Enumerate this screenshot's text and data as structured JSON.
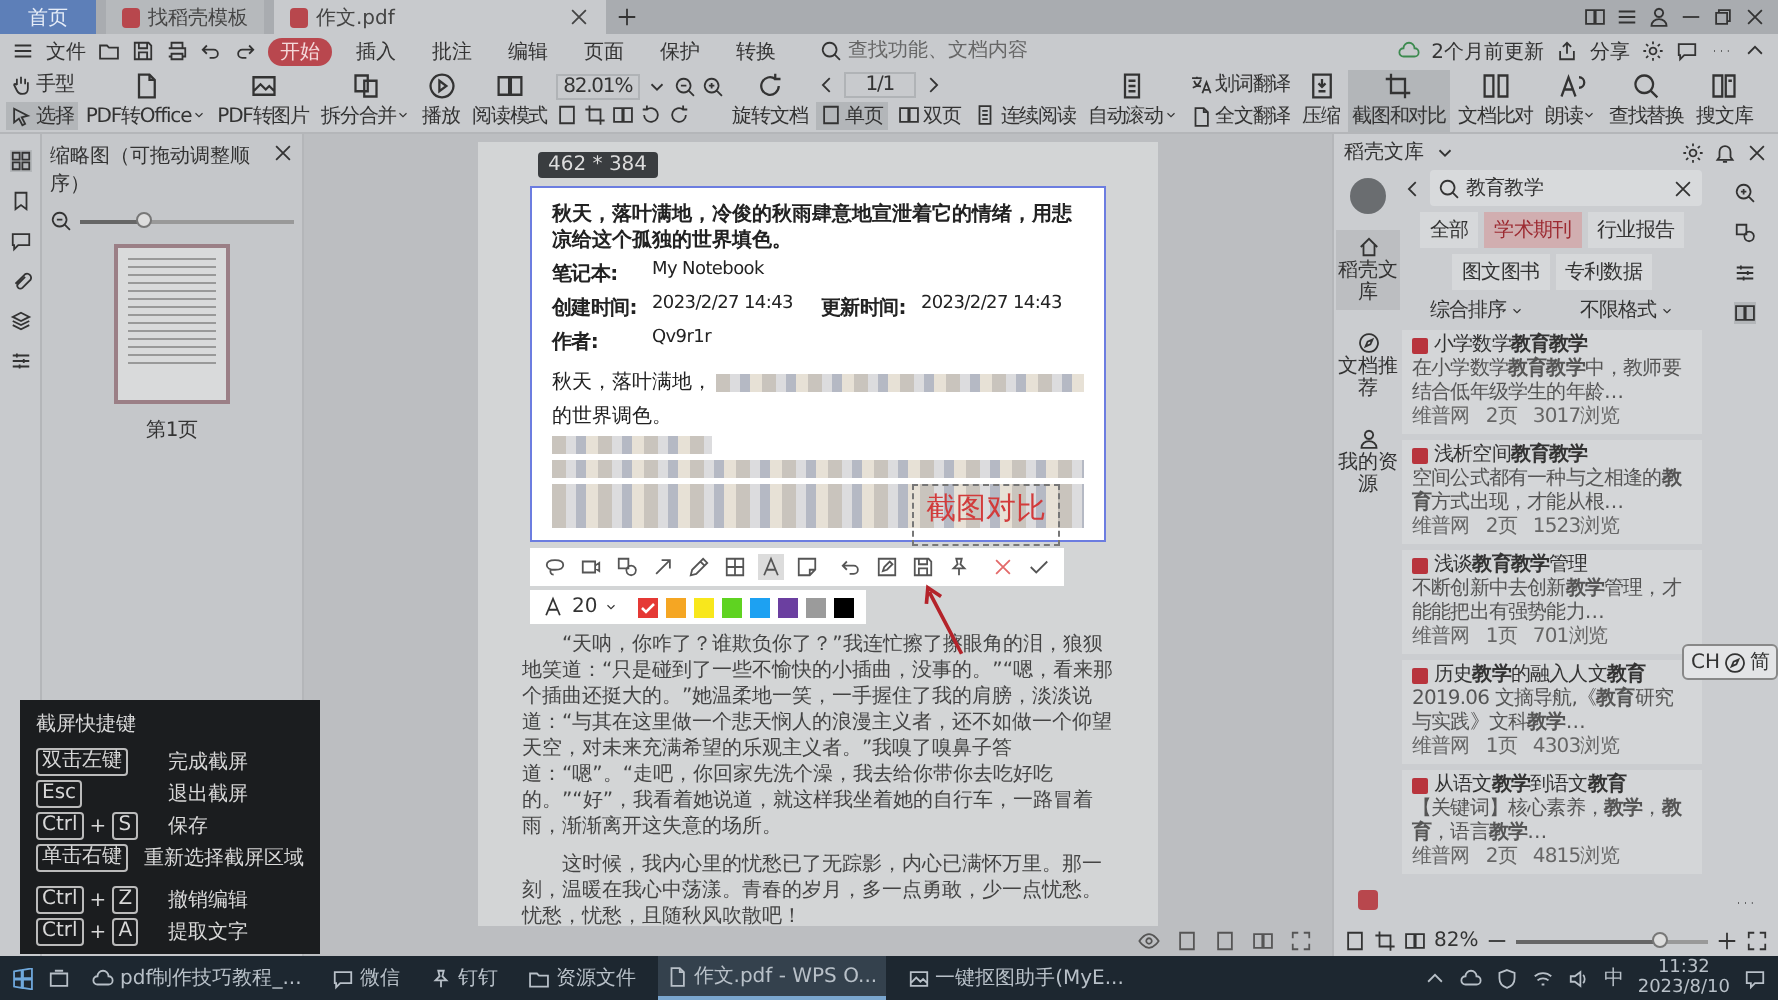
{
  "tabs": [
    {
      "label": "首页",
      "kind": "home",
      "selected": false
    },
    {
      "label": "找稻壳模板",
      "kind": "doc",
      "selected": false
    },
    {
      "label": "作文.pdf",
      "kind": "doc",
      "selected": true
    }
  ],
  "menu": {
    "file": "文件",
    "items": [
      {
        "label": "开始",
        "selected": true
      },
      {
        "label": "插入",
        "selected": false
      },
      {
        "label": "批注",
        "selected": false
      },
      {
        "label": "编辑",
        "selected": false
      },
      {
        "label": "页面",
        "selected": false
      },
      {
        "label": "保护",
        "selected": false
      },
      {
        "label": "转换",
        "selected": false
      }
    ],
    "search": {
      "placeholder": "查找功能、文档内容"
    },
    "update": "2个月前更新",
    "share": "分享"
  },
  "toolbar": [
    {
      "kind": "stack",
      "items": [
        {
          "label": "手型",
          "selected": false
        },
        {
          "label": "选择",
          "selected": true
        }
      ]
    },
    {
      "kind": "big",
      "label": "PDF转Office",
      "dropdown": true,
      "selected": false
    },
    {
      "kind": "big",
      "label": "PDF转图片",
      "dropdown": false,
      "selected": false
    },
    {
      "kind": "big",
      "label": "拆分合并",
      "dropdown": true,
      "selected": false
    },
    {
      "kind": "big",
      "label": "播放",
      "dropdown": false,
      "selected": false
    },
    {
      "kind": "big",
      "label": "阅读模式",
      "dropdown": false,
      "selected": false
    },
    {
      "kind": "zoom",
      "value": "82.01%"
    },
    {
      "kind": "big",
      "label": "旋转文档",
      "dropdown": false,
      "selected": false
    },
    {
      "kind": "nav",
      "value": "1/1",
      "modes": [
        {
          "label": "单页",
          "selected": true
        },
        {
          "label": "双页",
          "selected": false
        },
        {
          "label": "连续阅读",
          "selected": false
        }
      ]
    },
    {
      "kind": "big",
      "label": "自动滚动",
      "dropdown": true,
      "selected": false
    },
    {
      "kind": "stack",
      "items": [
        {
          "label": "划词翻译",
          "selected": false
        },
        {
          "label": "全文翻译",
          "selected": false
        }
      ]
    },
    {
      "kind": "big",
      "label": "压缩",
      "dropdown": false,
      "selected": false
    },
    {
      "kind": "big",
      "label": "截图和对比",
      "dropdown": false,
      "selected": true
    },
    {
      "kind": "big",
      "label": "文档比对",
      "dropdown": false,
      "selected": false
    },
    {
      "kind": "big",
      "label": "朗读",
      "dropdown": true,
      "selected": false
    },
    {
      "kind": "big",
      "label": "查找替换",
      "dropdown": false,
      "selected": false
    },
    {
      "kind": "big",
      "label": "搜文库",
      "dropdown": false,
      "selected": false
    }
  ],
  "thumbnails": {
    "title": "缩略图（可拖动调整顺序）",
    "level": 0.3,
    "page_label": "第1页"
  },
  "document": {
    "size_tag": "462 * 384",
    "title": "秋天，落叶满地，冷俊的秋雨肆意地宣泄着它的情绪，用悲凉给这个孤独的世界填色。",
    "meta": [
      [
        {
          "label": "笔记本:",
          "value": "My Notebook"
        }
      ],
      [
        {
          "label": "创建时间:",
          "value": "2023/2/27 14:43"
        },
        {
          "label": "更新时间:",
          "value": "2023/2/27 14:43"
        }
      ],
      [
        {
          "label": "作者:",
          "value": "Qv9r1r"
        }
      ]
    ],
    "intro": "秋天，落叶满地，",
    "intro_end": "的世界调色。",
    "overlay_text": "截图对比",
    "tools": [
      {
        "selected": false
      },
      {
        "selected": false
      },
      {
        "selected": false
      },
      {
        "selected": false
      },
      {
        "selected": false
      },
      {
        "selected": false
      },
      {
        "selected": true
      },
      {
        "selected": false
      },
      {
        "selected": false
      },
      {
        "selected": false
      },
      {
        "selected": false
      },
      {
        "selected": false
      },
      {
        "selected": false
      },
      {
        "selected": false
      }
    ],
    "font_size": "20",
    "colors": [
      {
        "color": "#e53935",
        "selected": true
      },
      {
        "color": "#f5a623",
        "selected": false
      },
      {
        "color": "#f8e71c",
        "selected": false
      },
      {
        "color": "#5fd321",
        "selected": false
      },
      {
        "color": "#1da1f2",
        "selected": false
      },
      {
        "color": "#6b3fa0",
        "selected": false
      },
      {
        "color": "#9b9b9b",
        "selected": false
      },
      {
        "color": "#000000",
        "selected": false
      }
    ],
    "paragraphs": [
      "“天呐，你咋了？谁欺负你了？”我连忙擦了擦眼角的泪，狼狈地笑道：“只是碰到了一些不愉快的小插曲，没事的。”“嗯，看来那个插曲还挺大的。”她温柔地一笑，一手握住了我的肩膀，淡淡说道：“与其在这里做一个悲天悯人的浪漫主义者，还不如做一个仰望天空，对未来充满希望的乐观主义者。”我嗅了嗅鼻子答道：“嗯”。“走吧，你回家先洗个澡，我去给你带你去吃好吃的。”“好”，我看着她说道，就这样我坐着她的自行车，一路冒着雨，渐渐离开这失意的场所。",
      "这时候，我内心里的忧愁已了无踪影，内心已满怀万里。那一刻，温暖在我心中荡漾。青春的岁月，多一点勇敢，少一点忧愁。忧愁，忧愁，且随秋风吹散吧！"
    ]
  },
  "library": {
    "title": "稻壳文库",
    "nav": [
      {
        "label": "稻壳文库",
        "selected": true
      },
      {
        "label": "文档推荐",
        "selected": false
      },
      {
        "label": "我的资源",
        "selected": false
      }
    ],
    "search": {
      "value": "教育教学"
    },
    "filters": [
      {
        "label": "全部",
        "selected": false
      },
      {
        "label": "学术期刊",
        "selected": true
      },
      {
        "label": "行业报告",
        "selected": false
      },
      {
        "label": "图文图书",
        "selected": false
      },
      {
        "label": "专利数据",
        "selected": false
      }
    ],
    "sorts": [
      "综合排序",
      "不限格式"
    ],
    "cards": [
      {
        "title": "小学数学**教育教学**",
        "desc": "在小学数学**教育教学**中，教师要结合低年级学生的年龄…",
        "source": "维普网",
        "pages": "2页",
        "views": "3017浏览"
      },
      {
        "title": "浅析空间**教育教学**",
        "desc": "空间公式都有一种与之相逢的**教育**方式出现，才能从根…",
        "source": "维普网",
        "pages": "2页",
        "views": "1523浏览"
      },
      {
        "title": "浅谈**教育教学**管理",
        "desc": "不断创新中去创新**教学**管理，才能能把出有强势能力…",
        "source": "维普网",
        "pages": "1页",
        "views": "701浏览"
      },
      {
        "title": "历史**教学**的融入人文**教育**",
        "desc": "2019.06 文摘导航,《**教育**研究与实践》文科**教学**…",
        "source": "维普网",
        "pages": "1页",
        "views": "4303浏览"
      },
      {
        "title": "从语文**教学**到语文**教育**",
        "desc": "【关键词】核心素养，**教学**，**教育**，语言**教学**…",
        "source": "维普网",
        "pages": "2页",
        "views": "4815浏览"
      }
    ],
    "zoom": {
      "value": "82%",
      "level": 0.75
    }
  },
  "ime_badge": {
    "left": "CH",
    "right": "简"
  },
  "shortcuts": {
    "title": "截屏快捷键",
    "joiner": "+",
    "rows": [
      {
        "keys": [
          "双击左键"
        ],
        "action": "完成截屏"
      },
      {
        "keys": [
          "Esc"
        ],
        "action": "退出截屏"
      },
      {
        "keys": [
          "Ctrl",
          "S"
        ],
        "action": "保存"
      },
      {
        "keys": [
          "单击右键"
        ],
        "action": "重新选择截屏区域"
      },
      {
        "keys": [
          "Ctrl",
          "Z"
        ],
        "action": "撤销编辑"
      },
      {
        "keys": [
          "Ctrl",
          "A"
        ],
        "action": "提取文字"
      }
    ]
  },
  "taskbar": {
    "items": [
      {
        "label": "pdf制作技巧教程_...",
        "active": false
      },
      {
        "label": "微信",
        "active": false
      },
      {
        "label": "钉钉",
        "active": false
      },
      {
        "label": "资源文件",
        "active": false
      },
      {
        "label": "作文.pdf - WPS O...",
        "active": true
      },
      {
        "label": "一键抠图助手(MyE...",
        "active": false
      }
    ],
    "ime": "中",
    "time": "11:32",
    "date": "2023/8/10"
  }
}
